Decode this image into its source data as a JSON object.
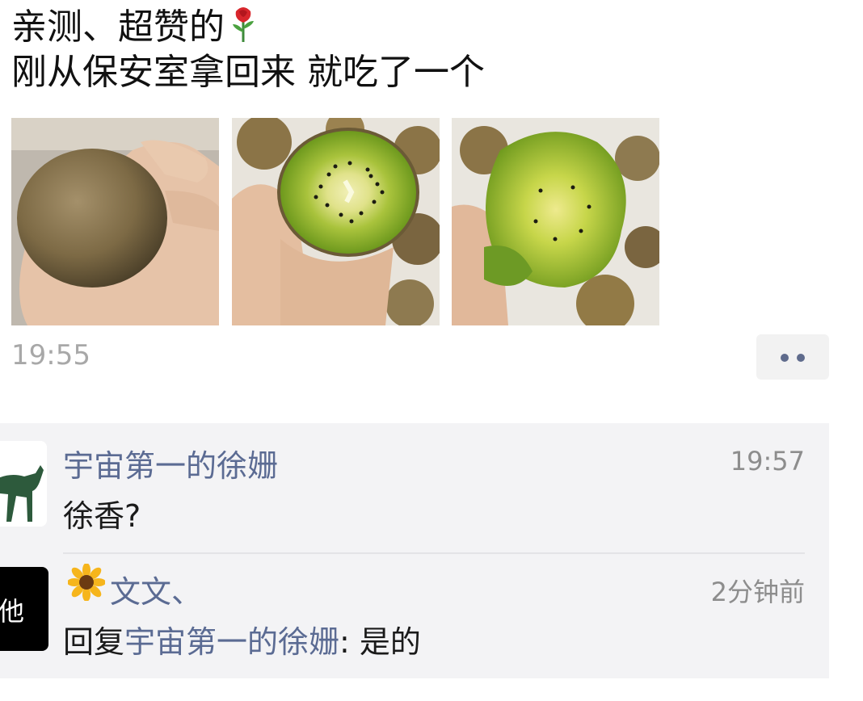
{
  "post": {
    "line1": "亲测、超赞的",
    "line2": "刚从保安室拿回来 就吃了一个",
    "photos": [
      {
        "icon": "kiwi-whole-in-hand-photo"
      },
      {
        "icon": "kiwi-halved-photo"
      },
      {
        "icon": "kiwi-eaten-photo"
      }
    ],
    "time": "19:55"
  },
  "comments": [
    {
      "author": "宇宙第一的徐姗",
      "time": "19:57",
      "text": "徐香?",
      "avatar_icon": "deer-icon"
    },
    {
      "author": "文文、",
      "time": "2分钟前",
      "reply_prefix": "回复",
      "reply_to": "宇宙第一的徐姗",
      "reply_sep": ": ",
      "text": "是的",
      "avatar_text": "他",
      "author_icon": "sunflower-icon"
    }
  ],
  "colors": {
    "link": "#5b6b93",
    "comment_bg": "#f3f3f5",
    "time": "#a8a8a8"
  }
}
